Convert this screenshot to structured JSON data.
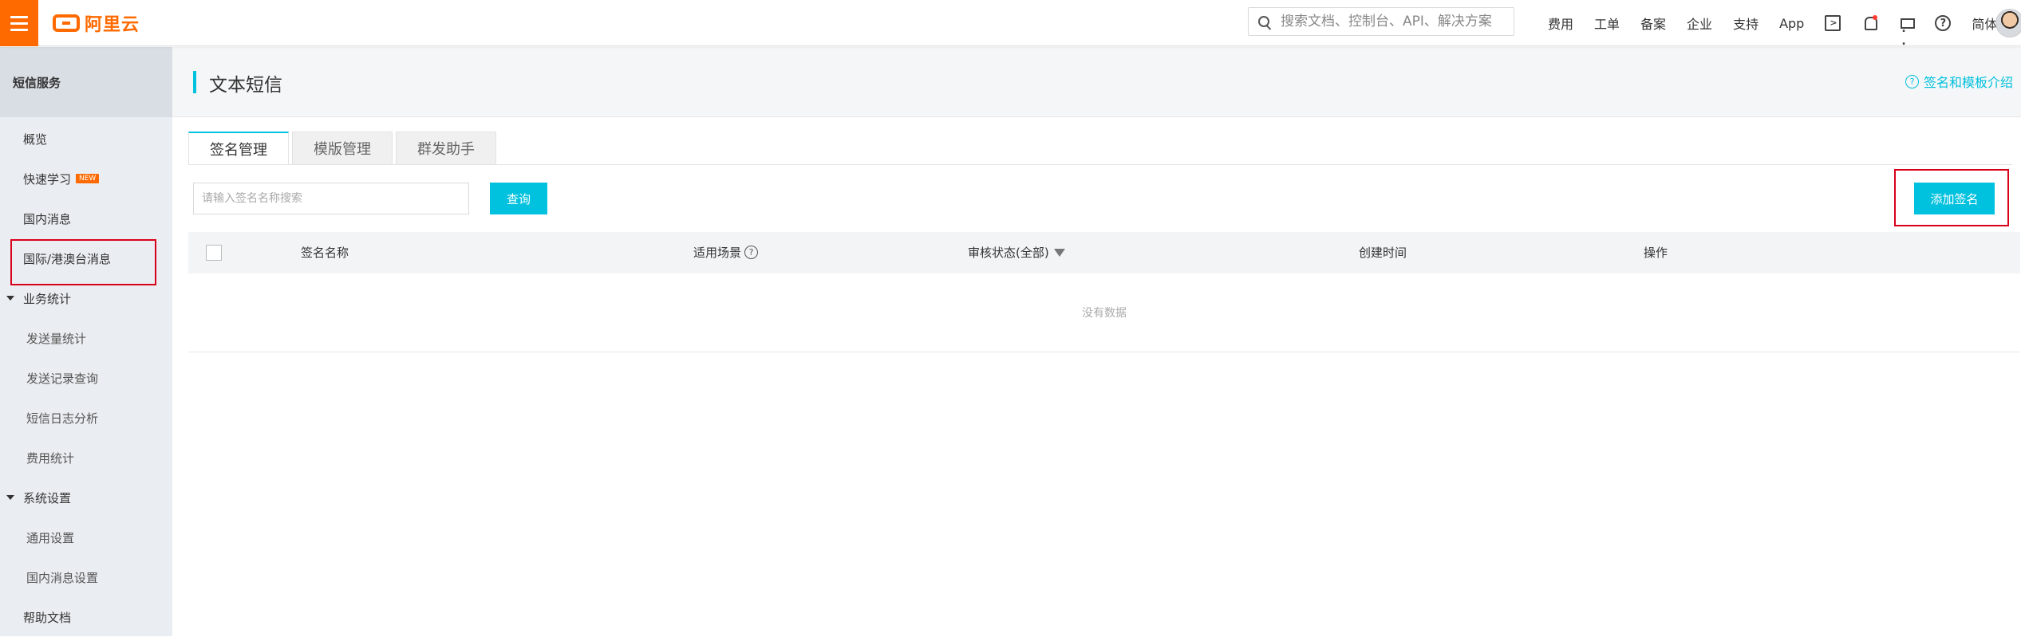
{
  "topbar": {
    "brand": "阿里云",
    "search_placeholder": "搜索文档、控制台、API、解决方案",
    "nav": [
      "费用",
      "工单",
      "备案",
      "企业",
      "支持",
      "App"
    ],
    "lang": "简体",
    "accent": "#ff6a00"
  },
  "sidebar": {
    "title": "短信服务",
    "items": [
      {
        "label": "概览"
      },
      {
        "label": "快速学习",
        "badge": "NEW"
      },
      {
        "label": "国内消息"
      },
      {
        "label": "国际/港澳台消息"
      },
      {
        "label": "业务统计"
      },
      {
        "label": "发送量统计"
      },
      {
        "label": "发送记录查询"
      },
      {
        "label": "短信日志分析"
      },
      {
        "label": "费用统计"
      },
      {
        "label": "系统设置"
      },
      {
        "label": "通用设置"
      },
      {
        "label": "国内消息设置"
      },
      {
        "label": "帮助文档"
      }
    ]
  },
  "main": {
    "title": "文本短信",
    "help_link": "签名和模板介绍",
    "tabs": [
      "签名管理",
      "模版管理",
      "群发助手"
    ],
    "filter": {
      "placeholder": "请输入签名名称搜索",
      "query_label": "查询"
    },
    "add_label": "添加签名",
    "columns": [
      "签名名称",
      "适用场景",
      "审核状态(全部)",
      "创建时间",
      "操作"
    ],
    "empty_text": "没有数据",
    "accent": "#00c1de"
  }
}
